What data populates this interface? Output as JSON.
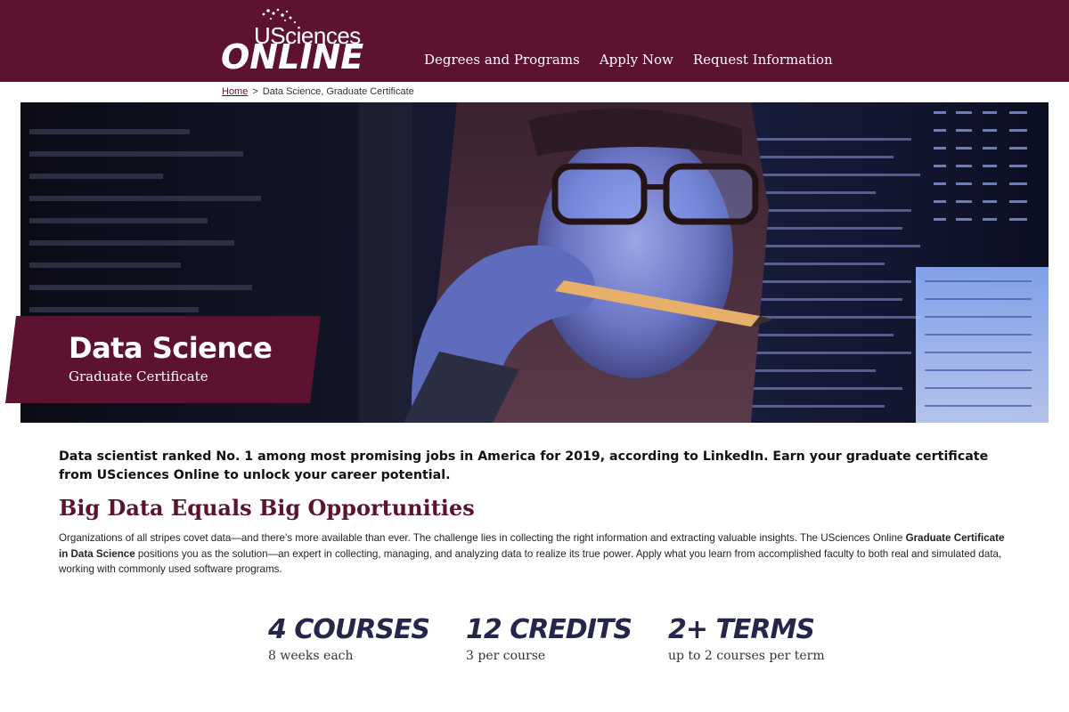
{
  "header": {
    "logo_top": "USciences",
    "logo_bottom": "ONLINE",
    "nav": [
      "Degrees and Programs",
      "Apply Now",
      "Request Information"
    ]
  },
  "breadcrumb": {
    "home": "Home",
    "separator": ">",
    "current": "Data Science, Graduate Certificate"
  },
  "hero": {
    "title": "Data Science",
    "subtitle": "Graduate Certificate"
  },
  "intro": {
    "lead": "Data scientist ranked No. 1 among most promising jobs in America for 2019, according to LinkedIn. Earn your graduate certificate from USciences Online to unlock your career potential."
  },
  "section": {
    "heading": "Big Data Equals Big Opportunities",
    "body_part1": "Organizations of all stripes covet data—and there’s more available than ever. The challenge lies in collecting the right information and extracting valuable insights. The USciences Online ",
    "body_bold": "Graduate Certificate in Data Science",
    "body_part2": " positions you as the solution—an expert in collecting, managing, and analyzing data to realize its true power. Apply what you learn from accomplished faculty to both real and simulated data, working with commonly used software programs."
  },
  "stats": [
    {
      "number": "4 COURSES",
      "label": "8 weeks each"
    },
    {
      "number": "12 CREDITS",
      "label": "3 per course"
    },
    {
      "number": "2+ TERMS",
      "label": "up to 2 courses per term"
    }
  ],
  "colors": {
    "brand": "#5e1232",
    "stat_text": "#25264a"
  }
}
